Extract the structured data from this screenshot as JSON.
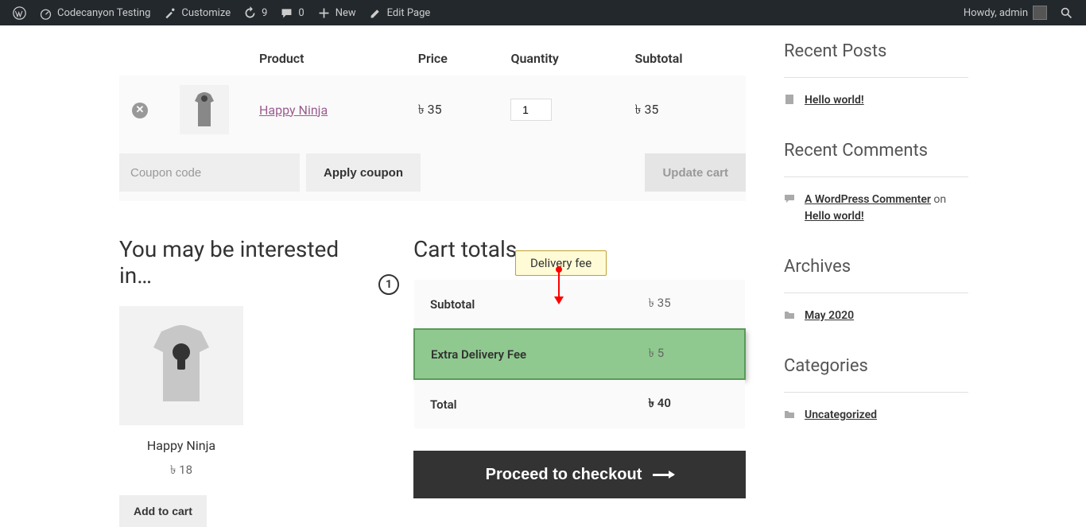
{
  "adminbar": {
    "site_name": "Codecanyon Testing",
    "customize": "Customize",
    "updates_count": "9",
    "comments_count": "0",
    "new": "New",
    "edit_page": "Edit Page",
    "howdy": "Howdy, admin"
  },
  "cart": {
    "headers": {
      "product": "Product",
      "price": "Price",
      "quantity": "Quantity",
      "subtotal": "Subtotal"
    },
    "currency_symbol": "৳ ",
    "items": [
      {
        "name": "Happy Ninja",
        "price": "35",
        "qty": "1",
        "subtotal": "35"
      }
    ],
    "coupon_placeholder": "Coupon code",
    "apply_coupon": "Apply coupon",
    "update_cart": "Update cart"
  },
  "cross_sells": {
    "heading": "You may be interested in…",
    "item": {
      "name": "Happy Ninja",
      "price": "18",
      "add": "Add to cart"
    }
  },
  "totals": {
    "heading": "Cart totals",
    "rows": {
      "subtotal_label": "Subtotal",
      "subtotal_value": "35",
      "fee_label": "Extra Delivery Fee",
      "fee_value": "5",
      "total_label": "Total",
      "total_value": "40"
    },
    "checkout": "Proceed to checkout"
  },
  "annotation": {
    "number": "1",
    "tooltip": "Delivery fee"
  },
  "sidebar": {
    "recent_posts": {
      "title": "Recent Posts",
      "items": [
        "Hello world!"
      ]
    },
    "recent_comments": {
      "title": "Recent Comments",
      "commenter": "A WordPress Commenter",
      "on": " on ",
      "post": "Hello world!"
    },
    "archives": {
      "title": "Archives",
      "items": [
        "May 2020"
      ]
    },
    "categories": {
      "title": "Categories",
      "items": [
        "Uncategorized"
      ]
    }
  }
}
